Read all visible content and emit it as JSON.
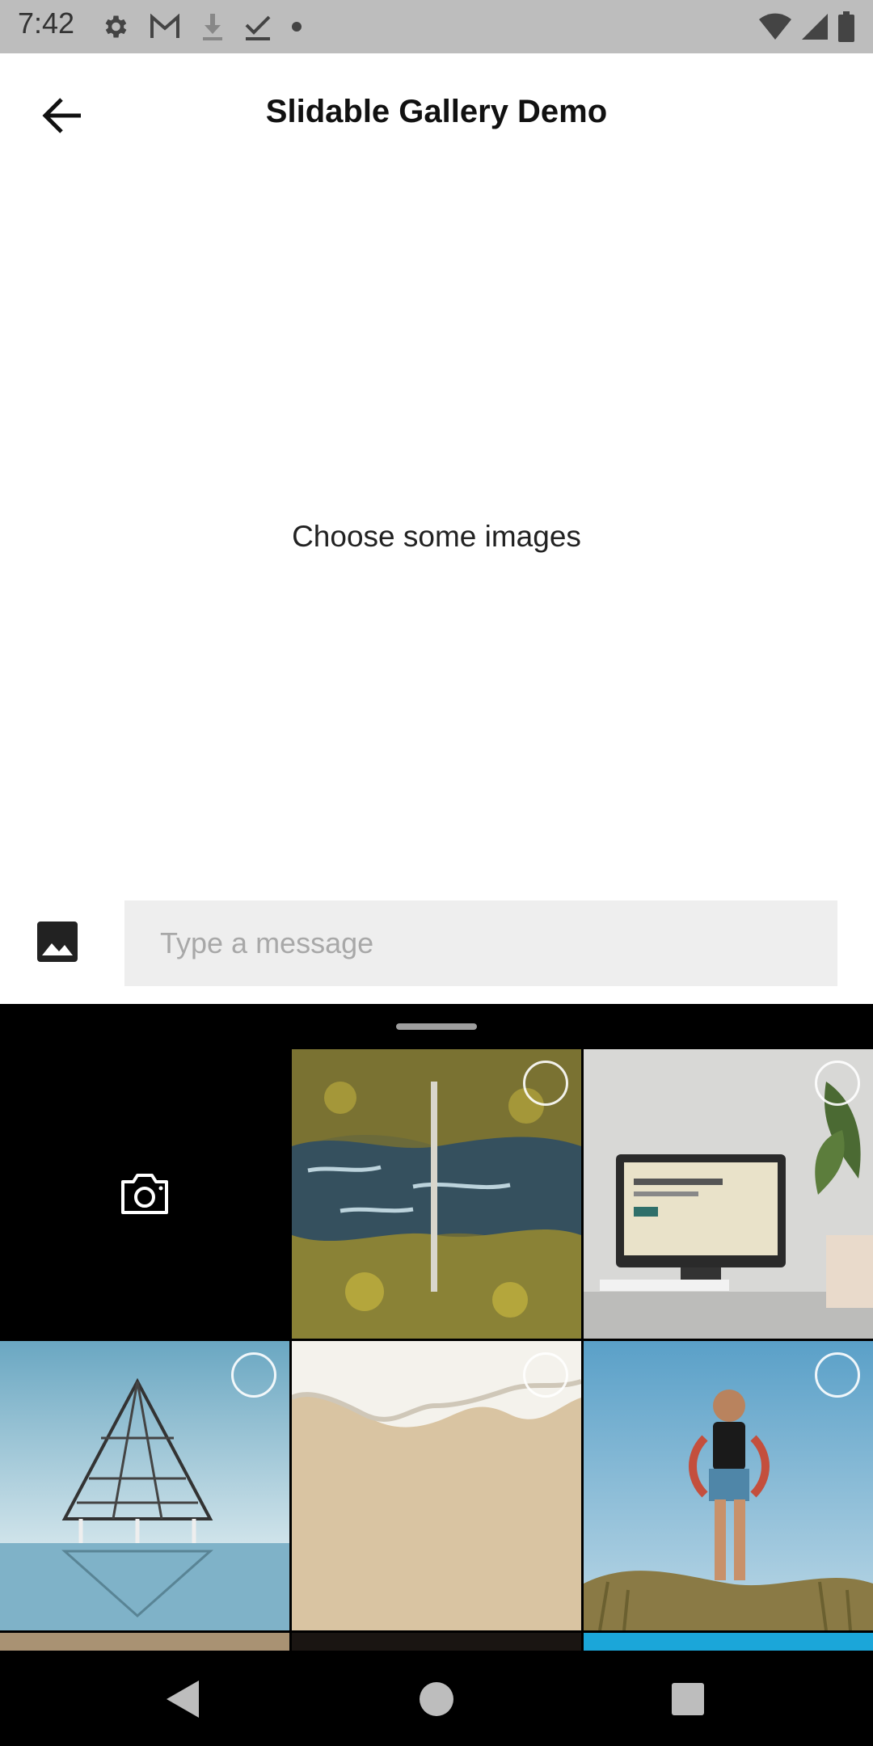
{
  "status_bar": {
    "time": "7:42",
    "left_icons": [
      "settings-icon",
      "gmail-icon",
      "download-icon",
      "check-icon",
      "dot-icon"
    ],
    "right_icons": [
      "wifi-icon",
      "signal-icon",
      "battery-icon"
    ]
  },
  "app_bar": {
    "title": "Slidable Gallery Demo",
    "back_icon": "arrow-back-icon"
  },
  "content": {
    "empty_message": "Choose some images"
  },
  "composer": {
    "gallery_icon": "image-icon",
    "input_placeholder": "Type a message",
    "input_value": ""
  },
  "gallery_sheet": {
    "camera_icon": "camera-icon",
    "photos": [
      {
        "subject": "aerial-river-forest"
      },
      {
        "subject": "desk-computer"
      },
      {
        "subject": "triangle-tower-water"
      },
      {
        "subject": "sand-beach-foam"
      },
      {
        "subject": "woman-field"
      }
    ]
  },
  "nav_bar": {
    "icons": [
      "back-triangle-icon",
      "home-circle-icon",
      "recents-square-icon"
    ]
  }
}
